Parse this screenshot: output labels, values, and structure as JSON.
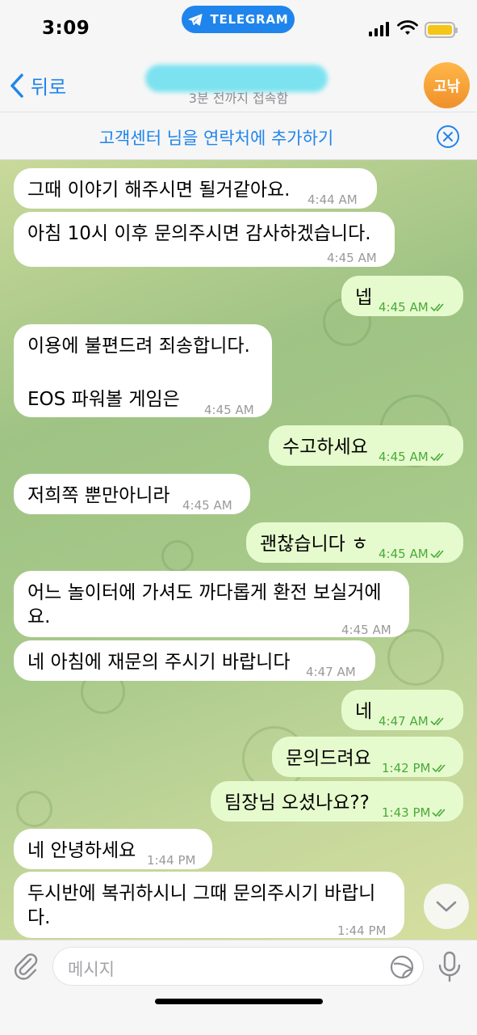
{
  "status_bar": {
    "time": "3:09",
    "telegram_pill": "TELEGRAM"
  },
  "nav": {
    "back_label": "뒤로",
    "chat_status": "3분 전까지 접속함",
    "avatar_initials": "고낚"
  },
  "banner": {
    "add_contact_label": "고객센터 님을 연락처에 추가하기"
  },
  "messages": [
    {
      "direction": "in",
      "lines": [
        "그때 이야기 해주시면 될거같아요."
      ],
      "time": "4:44 AM"
    },
    {
      "direction": "in",
      "lines": [
        "아침 10시 이후 문의주시면 감사하겠습니다."
      ],
      "time": "4:45 AM"
    },
    {
      "direction": "out",
      "lines": [
        "넵"
      ],
      "time": "4:45 AM",
      "read": true
    },
    {
      "direction": "in",
      "lines": [
        "이용에 불편드려 죄송합니다.",
        "",
        "EOS 파워볼 게임은"
      ],
      "time": "4:45 AM"
    },
    {
      "direction": "out",
      "lines": [
        "수고하세요"
      ],
      "time": "4:45 AM",
      "read": true
    },
    {
      "direction": "in",
      "lines": [
        "저희쪽 뿐만아니라"
      ],
      "time": "4:45 AM"
    },
    {
      "direction": "out",
      "lines": [
        "괜찮습니다 ㅎ"
      ],
      "time": "4:45 AM",
      "read": true
    },
    {
      "direction": "in",
      "lines": [
        "어느 놀이터에 가셔도 까다롭게 환전 보실거에",
        "요."
      ],
      "time": "4:45 AM"
    },
    {
      "direction": "in",
      "lines": [
        "네 아침에 재문의 주시기 바랍니다"
      ],
      "time": "4:47 AM"
    },
    {
      "direction": "out",
      "lines": [
        "네"
      ],
      "time": "4:47 AM",
      "read": true
    },
    {
      "direction": "out",
      "lines": [
        "문의드려요"
      ],
      "time": "1:42 PM",
      "read": true
    },
    {
      "direction": "out",
      "lines": [
        "팀장님 오셨나요??"
      ],
      "time": "1:43 PM",
      "read": true
    },
    {
      "direction": "in",
      "lines": [
        "네 안녕하세요"
      ],
      "time": "1:44 PM"
    },
    {
      "direction": "in",
      "lines": [
        "두시반에 복귀하시니 그때 문의주시기 바랍니",
        "다."
      ],
      "time": "1:44 PM"
    }
  ],
  "input": {
    "placeholder": "메시지"
  },
  "colors": {
    "accent": "#1f85ec",
    "incoming_bubble": "#ffffff",
    "outgoing_bubble": "#e6fbcd",
    "read_check": "#4aa93b",
    "avatar": "#f5a23a"
  },
  "icons": [
    "telegram-plane-icon",
    "signal-icon",
    "wifi-icon",
    "battery-icon",
    "chevron-left-icon",
    "close-circle-icon",
    "double-check-icon",
    "chevron-down-icon",
    "paperclip-icon",
    "sticker-icon",
    "microphone-icon"
  ]
}
